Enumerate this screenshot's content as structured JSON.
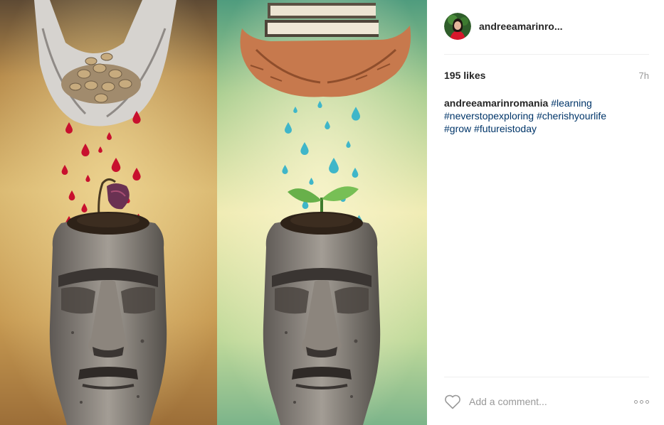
{
  "post": {
    "author": {
      "username": "andreeamarinro..."
    },
    "likes_text": "195 likes",
    "timestamp": "7h",
    "caption": {
      "username": "andreeamarinromania",
      "hashtags": [
        "#learning",
        "#neverstopexploring",
        "#cherishyourlife",
        "#grow",
        "#futureistoday"
      ]
    },
    "comment_box": {
      "placeholder": "Add a comment..."
    },
    "icons": {
      "like": "heart-icon",
      "more": "more-options-icon"
    }
  },
  "colors": {
    "text": "#262626",
    "muted": "#999999",
    "hashtag": "#003569",
    "divider": "#efefef",
    "blood_drop": "#c8102e",
    "water_drop": "#3fb6c9"
  }
}
